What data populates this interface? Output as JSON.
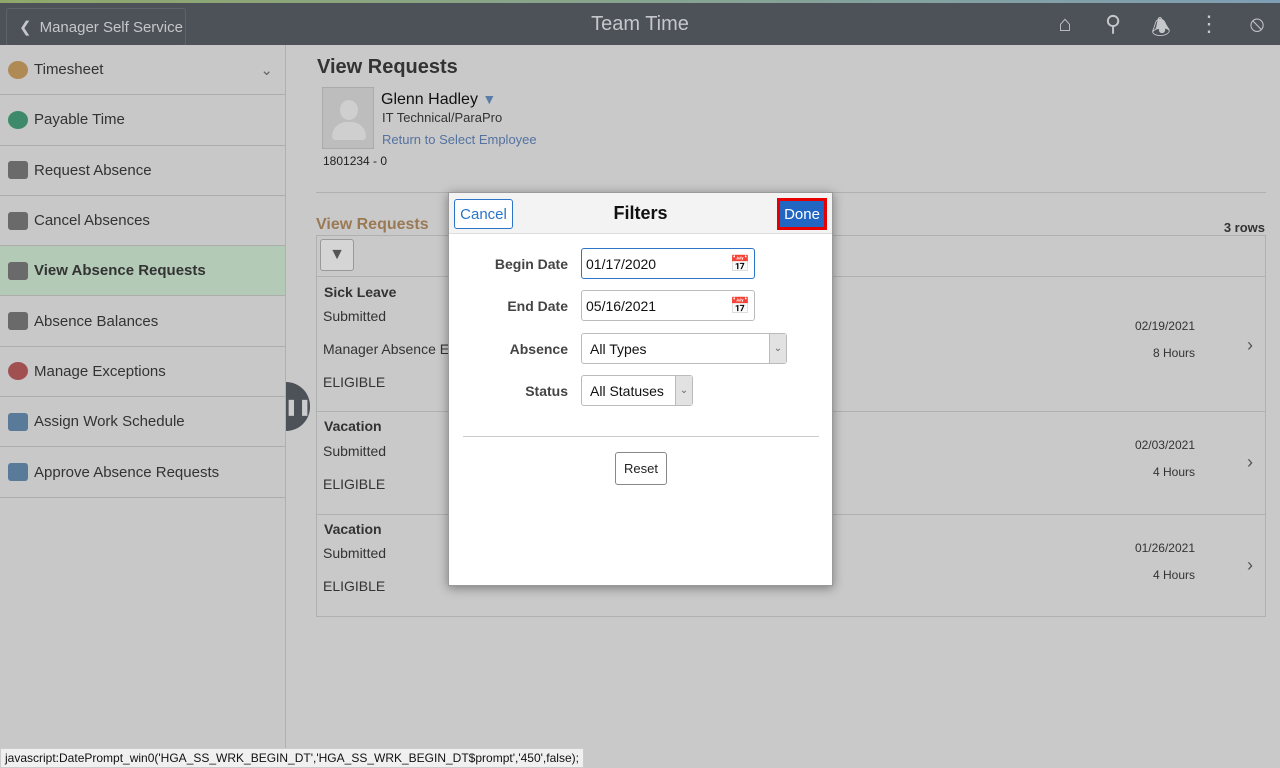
{
  "header": {
    "back_label": "Manager Self Service",
    "title": "Team Time",
    "icons": [
      "home-icon",
      "search-icon",
      "bell-icon",
      "more-icon",
      "compass-icon"
    ]
  },
  "sidebar": {
    "items": [
      {
        "label": "Timesheet",
        "icon": "timesheet-icon"
      },
      {
        "label": "Payable Time",
        "icon": "payable-time-icon"
      },
      {
        "label": "Request Absence",
        "icon": "briefcase-icon"
      },
      {
        "label": "Cancel Absences",
        "icon": "briefcase-cancel-icon"
      },
      {
        "label": "View Absence Requests",
        "icon": "briefcase-view-icon",
        "active": true
      },
      {
        "label": "Absence Balances",
        "icon": "briefcase-balance-icon"
      },
      {
        "label": "Manage Exceptions",
        "icon": "exception-icon"
      },
      {
        "label": "Assign Work Schedule",
        "icon": "schedule-icon"
      },
      {
        "label": "Approve Absence Requests",
        "icon": "approve-icon"
      }
    ]
  },
  "page": {
    "title": "View Requests",
    "employee": {
      "name": "Glenn Hadley",
      "job": "IT Technical/ParaPro",
      "link": "Return to Select Employee",
      "id": "1801234 - 0"
    },
    "section_title": "View Requests",
    "row_count": "3 rows",
    "requests": [
      {
        "type": "Sick Leave",
        "status": "Submitted",
        "extra": "Manager Absence E",
        "eligibility": "ELIGIBLE",
        "date": "02/19/2021",
        "hours": "8 Hours"
      },
      {
        "type": "Vacation",
        "status": "Submitted",
        "eligibility": "ELIGIBLE",
        "date": "02/03/2021",
        "hours": "4 Hours"
      },
      {
        "type": "Vacation",
        "status": "Submitted",
        "eligibility": "ELIGIBLE",
        "date": "01/26/2021",
        "hours": "4 Hours"
      }
    ]
  },
  "modal": {
    "title": "Filters",
    "cancel": "Cancel",
    "done": "Done",
    "reset": "Reset",
    "begin_label": "Begin Date",
    "begin_value": "01/17/2020",
    "end_label": "End Date",
    "end_value": "05/16/2021",
    "absence_label": "Absence",
    "absence_value": "All Types",
    "status_label": "Status",
    "status_value": "All Statuses"
  },
  "statusbar": "javascript:DatePrompt_win0('HGA_SS_WRK_BEGIN_DT','HGA_SS_WRK_BEGIN_DT$prompt','450',false);",
  "colors": {
    "header": "#4d5158",
    "done": "#2266c4",
    "highlight": "#e60000",
    "active": "#b3cab7"
  }
}
